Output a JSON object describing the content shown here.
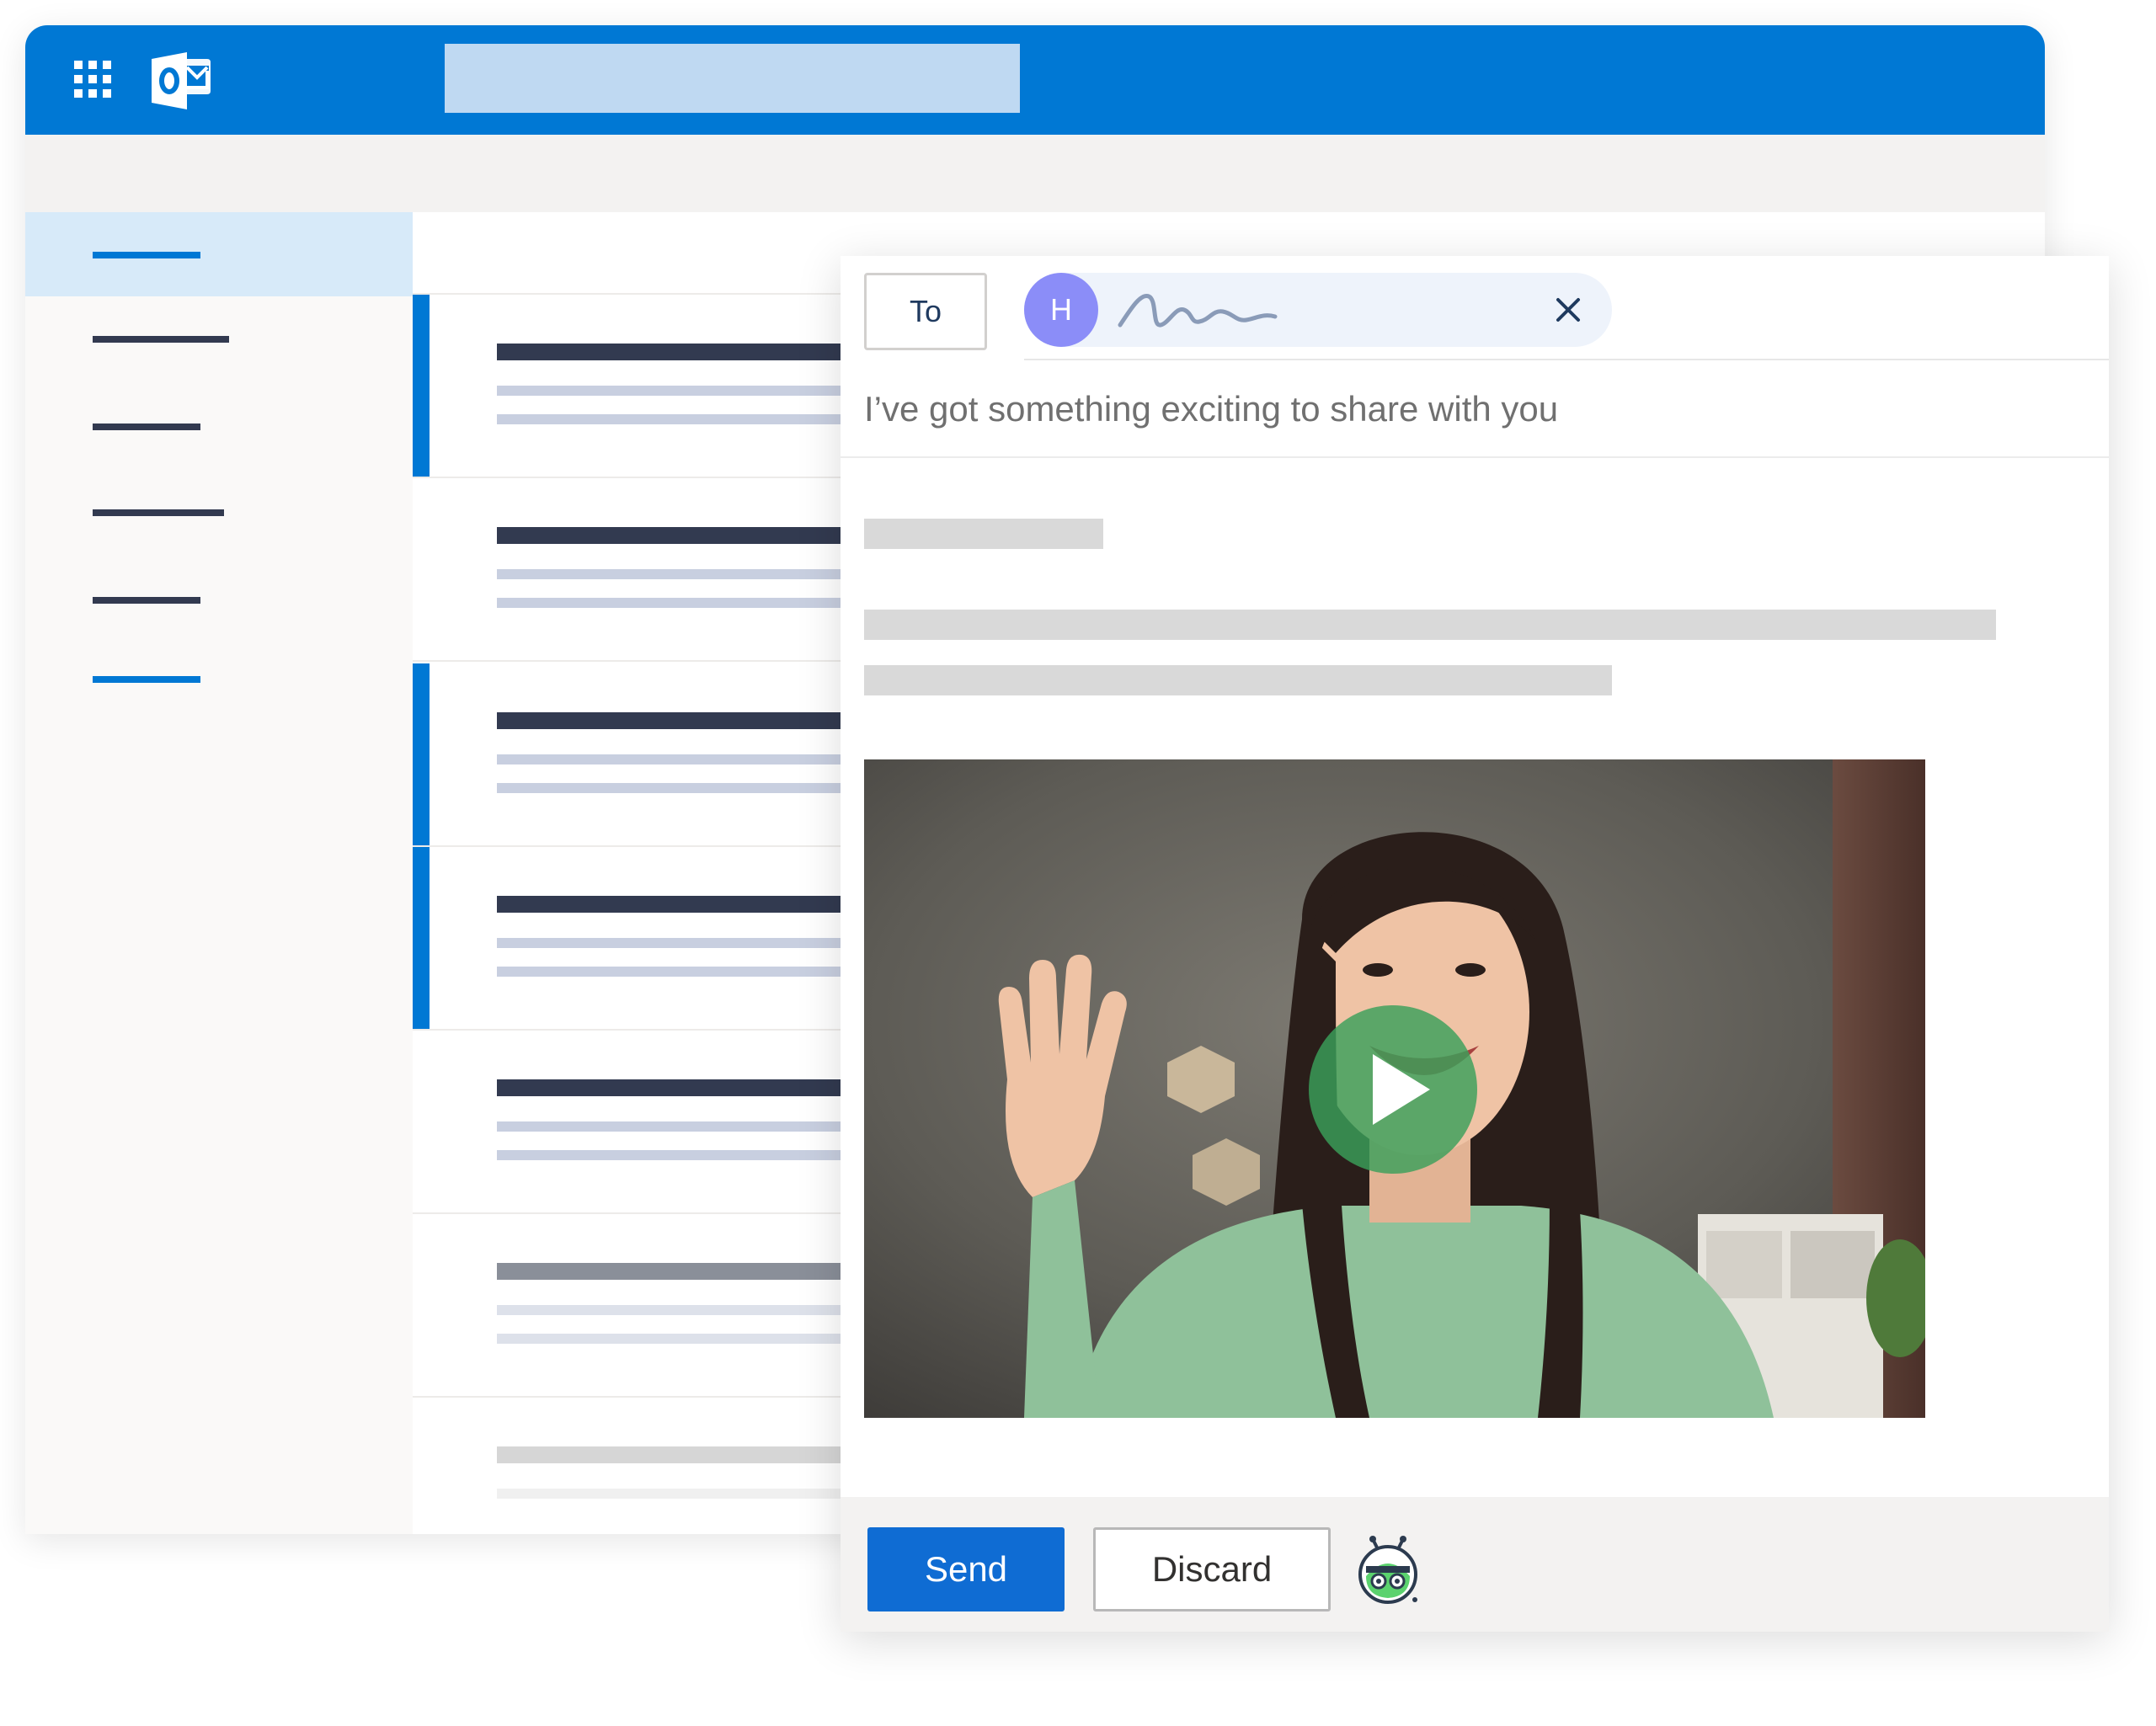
{
  "app": {
    "name": "Outlook",
    "brand_color": "#0078d4",
    "icons": [
      "app-launcher-icon",
      "outlook-logo-icon"
    ]
  },
  "compose": {
    "to_label": "To",
    "recipient": {
      "initial": "H",
      "avatar_color": "#8b8df8",
      "remove_icon": "close-icon"
    },
    "subject": "I’ve got something exciting to share with you",
    "video": {
      "play_icon": "play-icon",
      "play_color": "#3aa05a"
    },
    "footer": {
      "send_label": "Send",
      "discard_label": "Discard",
      "extension_icon": "bot-icon"
    }
  }
}
